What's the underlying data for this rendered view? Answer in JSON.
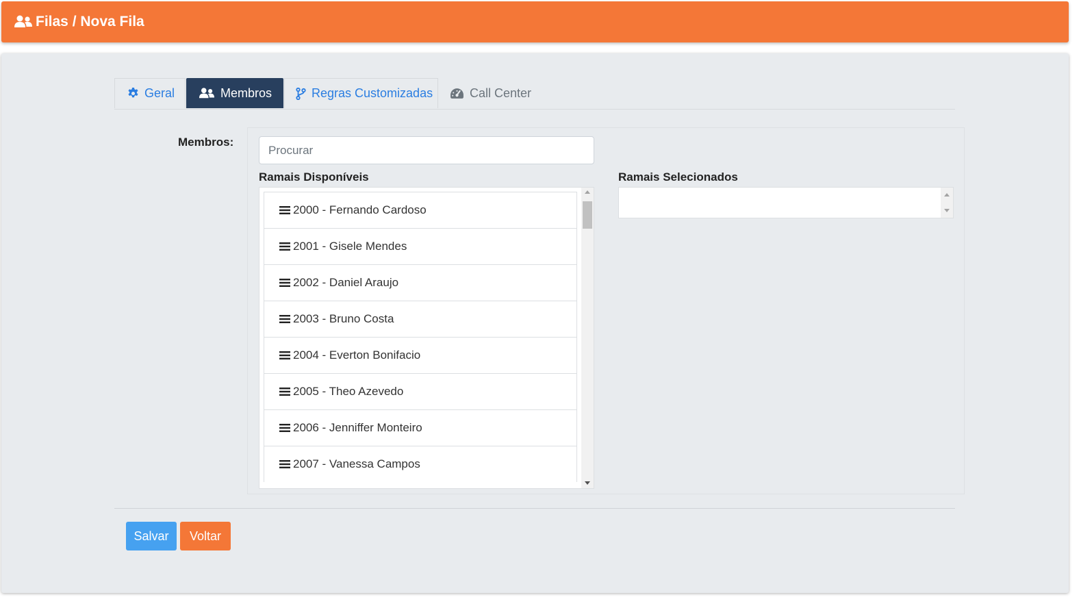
{
  "header": {
    "title": "Filas  /  Nova Fila",
    "icon": "users-icon",
    "bg_color": "#f47737"
  },
  "tabs": [
    {
      "label": "Geral",
      "icon": "gear-icon",
      "active": false
    },
    {
      "label": "Membros",
      "icon": "users-icon",
      "active": true
    },
    {
      "label": "Regras Customizadas",
      "icon": "code-branch-icon",
      "active": false
    },
    {
      "label": "Call Center",
      "icon": "tachometer-icon",
      "active": false
    }
  ],
  "members": {
    "label": "Membros:",
    "search_placeholder": "Procurar",
    "available_label": "Ramais Disponíveis",
    "selected_label": "Ramais Selecionados",
    "available": [
      "2000 - Fernando Cardoso",
      "2001 - Gisele Mendes",
      "2002 - Daniel Araujo",
      "2003 - Bruno Costa",
      "2004 - Everton Bonifacio",
      "2005 - Theo Azevedo",
      "2006 - Jenniffer Monteiro",
      "2007 - Vanessa Campos"
    ],
    "selected": []
  },
  "actions": {
    "save_label": "Salvar",
    "back_label": "Voltar",
    "save_color": "#46a1f0",
    "back_color": "#f47737"
  }
}
